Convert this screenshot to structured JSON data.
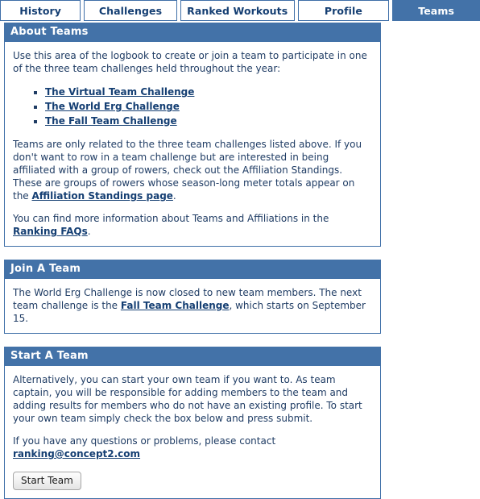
{
  "tabs": [
    {
      "label": "History",
      "active": false
    },
    {
      "label": "Challenges",
      "active": false
    },
    {
      "label": "Ranked Workouts",
      "active": false
    },
    {
      "label": "Profile",
      "active": false
    },
    {
      "label": "Teams",
      "active": true
    }
  ],
  "colors": {
    "header_blue": "#4372a8",
    "border_blue": "#3f6fa8",
    "text_navy": "#1f3c64",
    "link_navy": "#153f73",
    "tab_active_text": "#ffffff"
  },
  "about": {
    "title": "About Teams",
    "intro": "Use this area of the logbook to create or join a team to participate in one of the three team challenges held throughout the year:",
    "challenges": [
      "The Virtual Team Challenge",
      "The World Erg Challenge",
      "The Fall Team Challenge"
    ],
    "paragraph2_before": "Teams are only related to the three team challenges listed above. If you don't want to row in a team challenge but are interested in being affiliated with a group of rowers, check out the Affiliation Standings. These are groups of rowers whose season-long meter totals appear on the ",
    "paragraph2_link": "Affiliation Standings page",
    "paragraph2_after": ".",
    "paragraph3_before": "You can find more information about Teams and Affiliations in the ",
    "paragraph3_link": "Ranking FAQs",
    "paragraph3_after": "."
  },
  "join": {
    "title": "Join A Team",
    "text_before": "The World Erg Challenge is now closed to new team members. The next team challenge is the ",
    "link": "Fall Team Challenge",
    "text_after": ", which starts on September 15."
  },
  "start": {
    "title": "Start A Team",
    "paragraph1": "Alternatively, you can start your own team if you want to. As team captain, you will be responsible for adding members to the team and adding results for members who do not have an existing profile. To start your own team simply check the box below and press submit.",
    "contact_text": "If you have any questions or problems, please contact",
    "contact_email": "ranking@concept2.com",
    "button_label": "Start Team"
  }
}
